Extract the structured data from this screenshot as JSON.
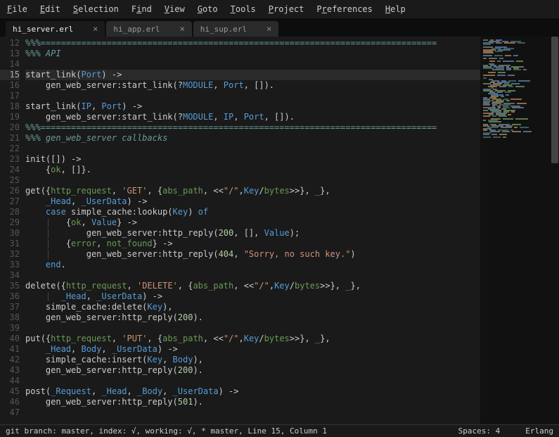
{
  "menu": [
    "File",
    "Edit",
    "Selection",
    "Find",
    "View",
    "Goto",
    "Tools",
    "Project",
    "Preferences",
    "Help"
  ],
  "menu_accel": [
    0,
    0,
    0,
    1,
    0,
    0,
    0,
    0,
    1,
    0
  ],
  "tabs": [
    {
      "label": "hi_server.erl",
      "active": true
    },
    {
      "label": "hi_app.erl",
      "active": false
    },
    {
      "label": "hi_sup.erl",
      "active": false
    }
  ],
  "first_line": 12,
  "active_line": 15,
  "lines": [
    [
      {
        "c": "c-comment",
        "t": "%%%=============================================================================="
      }
    ],
    [
      {
        "c": "c-comment",
        "t": "%%% API"
      }
    ],
    [],
    [
      {
        "c": "c-func",
        "t": "start_link"
      },
      {
        "c": "c-punct",
        "t": "("
      },
      {
        "c": "c-upper",
        "t": "Port"
      },
      {
        "c": "c-punct",
        "t": ") "
      },
      {
        "c": "c-arrow",
        "t": "->"
      }
    ],
    [
      {
        "c": "",
        "t": "    gen_web_server:start_link(?"
      },
      {
        "c": "c-var",
        "t": "MODULE"
      },
      {
        "c": "",
        "t": ", "
      },
      {
        "c": "c-upper",
        "t": "Port"
      },
      {
        "c": "",
        "t": ", [])."
      }
    ],
    [],
    [
      {
        "c": "c-func",
        "t": "start_link"
      },
      {
        "c": "c-punct",
        "t": "("
      },
      {
        "c": "c-upper",
        "t": "IP"
      },
      {
        "c": "",
        "t": ", "
      },
      {
        "c": "c-upper",
        "t": "Port"
      },
      {
        "c": "c-punct",
        "t": ") "
      },
      {
        "c": "c-arrow",
        "t": "->"
      }
    ],
    [
      {
        "c": "",
        "t": "    gen_web_server:start_link(?"
      },
      {
        "c": "c-var",
        "t": "MODULE"
      },
      {
        "c": "",
        "t": ", "
      },
      {
        "c": "c-upper",
        "t": "IP"
      },
      {
        "c": "",
        "t": ", "
      },
      {
        "c": "c-upper",
        "t": "Port"
      },
      {
        "c": "",
        "t": ", [])."
      }
    ],
    [
      {
        "c": "c-comment",
        "t": "%%%=============================================================================="
      }
    ],
    [
      {
        "c": "c-comment",
        "t": "%%% gen_web_server callbacks"
      }
    ],
    [],
    [
      {
        "c": "c-func",
        "t": "init"
      },
      {
        "c": "",
        "t": "([]) "
      },
      {
        "c": "c-arrow",
        "t": "->"
      }
    ],
    [
      {
        "c": "",
        "t": "    {"
      },
      {
        "c": "c-atom",
        "t": "ok"
      },
      {
        "c": "",
        "t": ", []}."
      }
    ],
    [],
    [
      {
        "c": "c-func",
        "t": "get"
      },
      {
        "c": "",
        "t": "({"
      },
      {
        "c": "c-atom",
        "t": "http_request"
      },
      {
        "c": "",
        "t": ", "
      },
      {
        "c": "c-string",
        "t": "'GET'"
      },
      {
        "c": "",
        "t": ", {"
      },
      {
        "c": "c-atom",
        "t": "abs_path"
      },
      {
        "c": "",
        "t": ", <<"
      },
      {
        "c": "c-string",
        "t": "\"/\""
      },
      {
        "c": "",
        "t": ","
      },
      {
        "c": "c-upper",
        "t": "Key"
      },
      {
        "c": "",
        "t": "/"
      },
      {
        "c": "c-atom",
        "t": "bytes"
      },
      {
        "c": "",
        "t": ">>}, "
      },
      {
        "c": "c-upper",
        "t": "_"
      },
      {
        "c": "",
        "t": "},"
      }
    ],
    [
      {
        "c": "",
        "t": "    "
      },
      {
        "c": "c-upper",
        "t": "_Head"
      },
      {
        "c": "",
        "t": ", "
      },
      {
        "c": "c-upper",
        "t": "_UserData"
      },
      {
        "c": "",
        "t": ") "
      },
      {
        "c": "c-arrow",
        "t": "->"
      }
    ],
    [
      {
        "c": "",
        "t": "    "
      },
      {
        "c": "c-keyword",
        "t": "case"
      },
      {
        "c": "",
        "t": " simple_cache:lookup("
      },
      {
        "c": "c-upper",
        "t": "Key"
      },
      {
        "c": "",
        "t": ") "
      },
      {
        "c": "c-keyword",
        "t": "of"
      }
    ],
    [
      {
        "c": "",
        "t": "    "
      },
      {
        "c": "c-vert",
        "t": "|"
      },
      {
        "c": "",
        "t": "   {"
      },
      {
        "c": "c-atom",
        "t": "ok"
      },
      {
        "c": "",
        "t": ", "
      },
      {
        "c": "c-upper",
        "t": "Value"
      },
      {
        "c": "",
        "t": "} "
      },
      {
        "c": "c-arrow",
        "t": "->"
      }
    ],
    [
      {
        "c": "",
        "t": "    "
      },
      {
        "c": "c-vert",
        "t": "|"
      },
      {
        "c": "",
        "t": "       gen_web_server:http_reply("
      },
      {
        "c": "c-number",
        "t": "200"
      },
      {
        "c": "",
        "t": ", [], "
      },
      {
        "c": "c-upper",
        "t": "Value"
      },
      {
        "c": "",
        "t": ");"
      }
    ],
    [
      {
        "c": "",
        "t": "    "
      },
      {
        "c": "c-vert",
        "t": "|"
      },
      {
        "c": "",
        "t": "   {"
      },
      {
        "c": "c-atom",
        "t": "error"
      },
      {
        "c": "",
        "t": ", "
      },
      {
        "c": "c-atom",
        "t": "not_found"
      },
      {
        "c": "",
        "t": "} "
      },
      {
        "c": "c-arrow",
        "t": "->"
      }
    ],
    [
      {
        "c": "",
        "t": "    "
      },
      {
        "c": "c-vert",
        "t": "|"
      },
      {
        "c": "",
        "t": "       gen_web_server:http_reply("
      },
      {
        "c": "c-number",
        "t": "404"
      },
      {
        "c": "",
        "t": ", "
      },
      {
        "c": "c-string",
        "t": "\"Sorry, no such key.\""
      },
      {
        "c": "",
        "t": ")"
      }
    ],
    [
      {
        "c": "",
        "t": "    "
      },
      {
        "c": "c-keyword",
        "t": "end"
      },
      {
        "c": "",
        "t": "."
      }
    ],
    [],
    [
      {
        "c": "c-func",
        "t": "delete"
      },
      {
        "c": "",
        "t": "({"
      },
      {
        "c": "c-atom",
        "t": "http_request"
      },
      {
        "c": "",
        "t": ", "
      },
      {
        "c": "c-string",
        "t": "'DELETE'"
      },
      {
        "c": "",
        "t": ", {"
      },
      {
        "c": "c-atom",
        "t": "abs_path"
      },
      {
        "c": "",
        "t": ", <<"
      },
      {
        "c": "c-string",
        "t": "\"/\""
      },
      {
        "c": "",
        "t": ","
      },
      {
        "c": "c-upper",
        "t": "Key"
      },
      {
        "c": "",
        "t": "/"
      },
      {
        "c": "c-atom",
        "t": "bytes"
      },
      {
        "c": "",
        "t": ">>}, "
      },
      {
        "c": "c-upper",
        "t": "_"
      },
      {
        "c": "",
        "t": "},"
      }
    ],
    [
      {
        "c": "",
        "t": "    "
      },
      {
        "c": "c-vert",
        "t": "|"
      },
      {
        "c": "",
        "t": "  "
      },
      {
        "c": "c-upper",
        "t": "_Head"
      },
      {
        "c": "",
        "t": ", "
      },
      {
        "c": "c-upper",
        "t": "_UserData"
      },
      {
        "c": "",
        "t": ") "
      },
      {
        "c": "c-arrow",
        "t": "->"
      }
    ],
    [
      {
        "c": "",
        "t": "    simple_cache:delete("
      },
      {
        "c": "c-upper",
        "t": "Key"
      },
      {
        "c": "",
        "t": "),"
      }
    ],
    [
      {
        "c": "",
        "t": "    gen_web_server:http_reply("
      },
      {
        "c": "c-number",
        "t": "200"
      },
      {
        "c": "",
        "t": ")."
      }
    ],
    [],
    [
      {
        "c": "c-func",
        "t": "put"
      },
      {
        "c": "",
        "t": "({"
      },
      {
        "c": "c-atom",
        "t": "http_request"
      },
      {
        "c": "",
        "t": ", "
      },
      {
        "c": "c-string",
        "t": "'PUT'"
      },
      {
        "c": "",
        "t": ", {"
      },
      {
        "c": "c-atom",
        "t": "abs_path"
      },
      {
        "c": "",
        "t": ", <<"
      },
      {
        "c": "c-string",
        "t": "\"/\""
      },
      {
        "c": "",
        "t": ","
      },
      {
        "c": "c-upper",
        "t": "Key"
      },
      {
        "c": "",
        "t": "/"
      },
      {
        "c": "c-atom",
        "t": "bytes"
      },
      {
        "c": "",
        "t": ">>}, "
      },
      {
        "c": "c-upper",
        "t": "_"
      },
      {
        "c": "",
        "t": "},"
      }
    ],
    [
      {
        "c": "",
        "t": "    "
      },
      {
        "c": "c-upper",
        "t": "_Head"
      },
      {
        "c": "",
        "t": ", "
      },
      {
        "c": "c-upper",
        "t": "Body"
      },
      {
        "c": "",
        "t": ", "
      },
      {
        "c": "c-upper",
        "t": "_UserData"
      },
      {
        "c": "",
        "t": ") "
      },
      {
        "c": "c-arrow",
        "t": "->"
      }
    ],
    [
      {
        "c": "",
        "t": "    simple_cache:insert("
      },
      {
        "c": "c-upper",
        "t": "Key"
      },
      {
        "c": "",
        "t": ", "
      },
      {
        "c": "c-upper",
        "t": "Body"
      },
      {
        "c": "",
        "t": "),"
      }
    ],
    [
      {
        "c": "",
        "t": "    gen_web_server:http_reply("
      },
      {
        "c": "c-number",
        "t": "200"
      },
      {
        "c": "",
        "t": ")."
      }
    ],
    [],
    [
      {
        "c": "c-func",
        "t": "post"
      },
      {
        "c": "",
        "t": "("
      },
      {
        "c": "c-upper",
        "t": "_Request"
      },
      {
        "c": "",
        "t": ", "
      },
      {
        "c": "c-upper",
        "t": "_Head"
      },
      {
        "c": "",
        "t": ", "
      },
      {
        "c": "c-upper",
        "t": "_Body"
      },
      {
        "c": "",
        "t": ", "
      },
      {
        "c": "c-upper",
        "t": "_UserData"
      },
      {
        "c": "",
        "t": ") "
      },
      {
        "c": "c-arrow",
        "t": "->"
      }
    ],
    [
      {
        "c": "",
        "t": "    gen_web_server:http_reply("
      },
      {
        "c": "c-number",
        "t": "501"
      },
      {
        "c": "",
        "t": ")."
      }
    ],
    []
  ],
  "status": {
    "left": "git branch: master, index: √, working: √, * master, Line 15, Column 1",
    "spaces": "Spaces: 4",
    "lang": "Erlang"
  }
}
